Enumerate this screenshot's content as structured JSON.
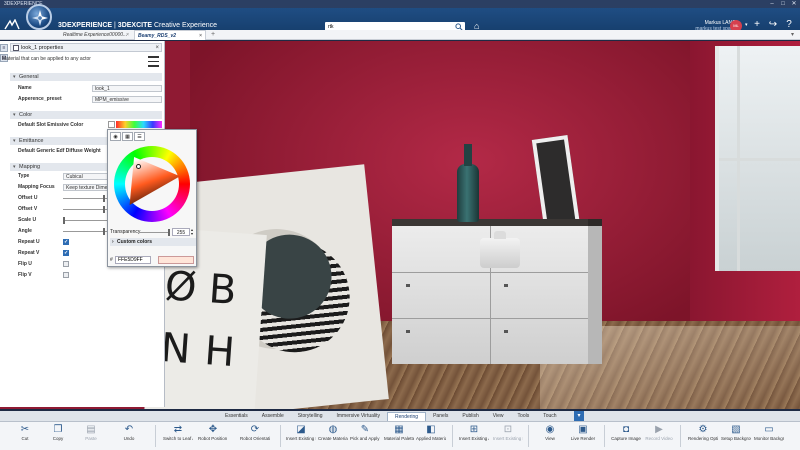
{
  "window": {
    "title": "3DEXPERIENCE",
    "controls": [
      "–",
      "□",
      "✕"
    ]
  },
  "topbar": {
    "brand_bold": "3DEXPERIENCE",
    "brand_sep": " | ",
    "brand_company": "3DEXCITE",
    "brand_app": " Creative Experience",
    "search_value": "rtk",
    "user_name": "Markus LANG",
    "user_space": "markus test space",
    "avatar_initials": "ML"
  },
  "tabs": [
    {
      "label": "Realtime Experience00000..."
    },
    {
      "label": "Beamy_RDS_v2"
    }
  ],
  "panel": {
    "title": "look_1 properties",
    "description": "Material that can be applied to any actor",
    "sections": {
      "general": "General",
      "color": "Color",
      "emittance": "Emittance",
      "mapping": "Mapping"
    },
    "fields": {
      "name_label": "Name",
      "name_value": "look_1",
      "preset_label": "Apperence_preset",
      "preset_value": "MPM_emissive",
      "emissive_color_label": "Default Slot Emissive Color",
      "diffuse_weight_label": "Default Generic Edf Diffuse Weight",
      "type_label": "Type",
      "type_value": "Cubical",
      "focus_label": "Mapping Focus",
      "focus_value": "Keep texture Dime",
      "offset_u": "Offset U",
      "offset_v": "Offset V",
      "scale_u": "Scale U",
      "angle": "Angle",
      "repeat_u": "Repeat U",
      "repeat_v": "Repeat V",
      "flip_u": "Flip U",
      "flip_v": "Flip V"
    }
  },
  "picker": {
    "transparency_label": "Transparency",
    "transparency_value": "255",
    "custom_colors_label": "Custom colors",
    "hex_value": "FFE5D9FF",
    "preview_color": "#FFE5D9"
  },
  "ribbon": {
    "tabs": [
      "Essentials",
      "Assemble",
      "Storytelling",
      "Immersive Virtuality",
      "Rendering",
      "Panels",
      "Publish",
      "View",
      "Tools",
      "Touch"
    ],
    "active_tab": "Rendering",
    "tools": {
      "cut": "Cut",
      "copy": "Copy",
      "paste": "Paste",
      "undo": "Undo",
      "switch_leaf": "Switch to Leaf Acto...",
      "robot_position": "Robot Position A...",
      "robot_orientation": "Robot Orientation...",
      "insert_existing_ma": "Insert Existing Ma...",
      "create_material": "Create Material",
      "pick_apply": "Pick and Apply ...",
      "material_palette": "Material Palette",
      "applied_materials": "Applied Materials",
      "insert_existing_a": "Insert Existing A...",
      "insert_existing_pl": "Insert Existing Pl...",
      "view": "View",
      "live_render": "Live Render",
      "capture_image": "Capture Image",
      "record_video": "Record Video",
      "rendering_options": "Rendering Options",
      "setup_background": "Setup Background...",
      "monitor_background": "Monitor Background..."
    }
  },
  "colors": {
    "accent": "#2d6cb3",
    "topbar": "#1f4d83",
    "wall": "#b32947"
  }
}
